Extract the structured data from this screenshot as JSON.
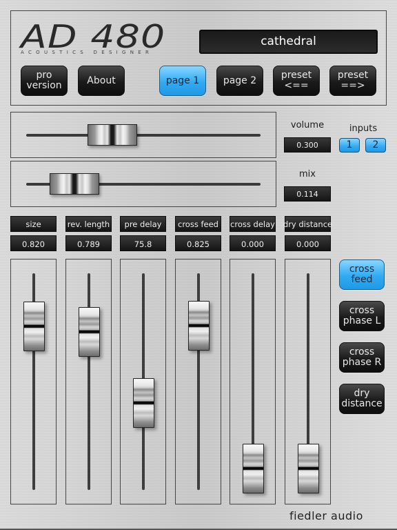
{
  "header": {
    "logo_text": "AD 480",
    "logo_subtitle": "ACOUSTICS DESIGNER",
    "preset_name": "cathedral",
    "buttons": {
      "pro_version": "pro\nversion",
      "about": "About",
      "page1": "page 1",
      "page2": "page 2",
      "preset_prev": "preset\n<==",
      "preset_next": "preset\n==>"
    },
    "active_page": "page 1"
  },
  "master": {
    "volume": {
      "label": "volume",
      "value": "0.300",
      "fraction": 0.3
    },
    "mix": {
      "label": "mix",
      "value": "0.114",
      "fraction": 0.114
    },
    "inputs": {
      "label": "inputs",
      "buttons": [
        "1",
        "2"
      ],
      "active": [
        "1",
        "2"
      ]
    }
  },
  "params": [
    {
      "name": "size",
      "value": "0.820",
      "fraction": 0.82
    },
    {
      "name": "rev. length",
      "value": "0.789",
      "fraction": 0.789
    },
    {
      "name": "pre delay",
      "value": "75.8",
      "fraction": 0.378
    },
    {
      "name": "cross feed",
      "value": "0.825",
      "fraction": 0.825
    },
    {
      "name": "cross delay",
      "value": "0.000",
      "fraction": 0.0
    },
    {
      "name": "dry distance",
      "value": "0.000",
      "fraction": 0.0
    }
  ],
  "side_buttons": [
    {
      "label": "cross\nfeed",
      "active": true
    },
    {
      "label": "cross\nphase L",
      "active": false
    },
    {
      "label": "cross\nphase R",
      "active": false
    },
    {
      "label": "dry\ndistance",
      "active": false
    }
  ],
  "brand": "fiedler audio",
  "colors": {
    "accent": "#33aaf2",
    "display_bg": "#1c1c1c",
    "panel": "#d0d0d0"
  }
}
